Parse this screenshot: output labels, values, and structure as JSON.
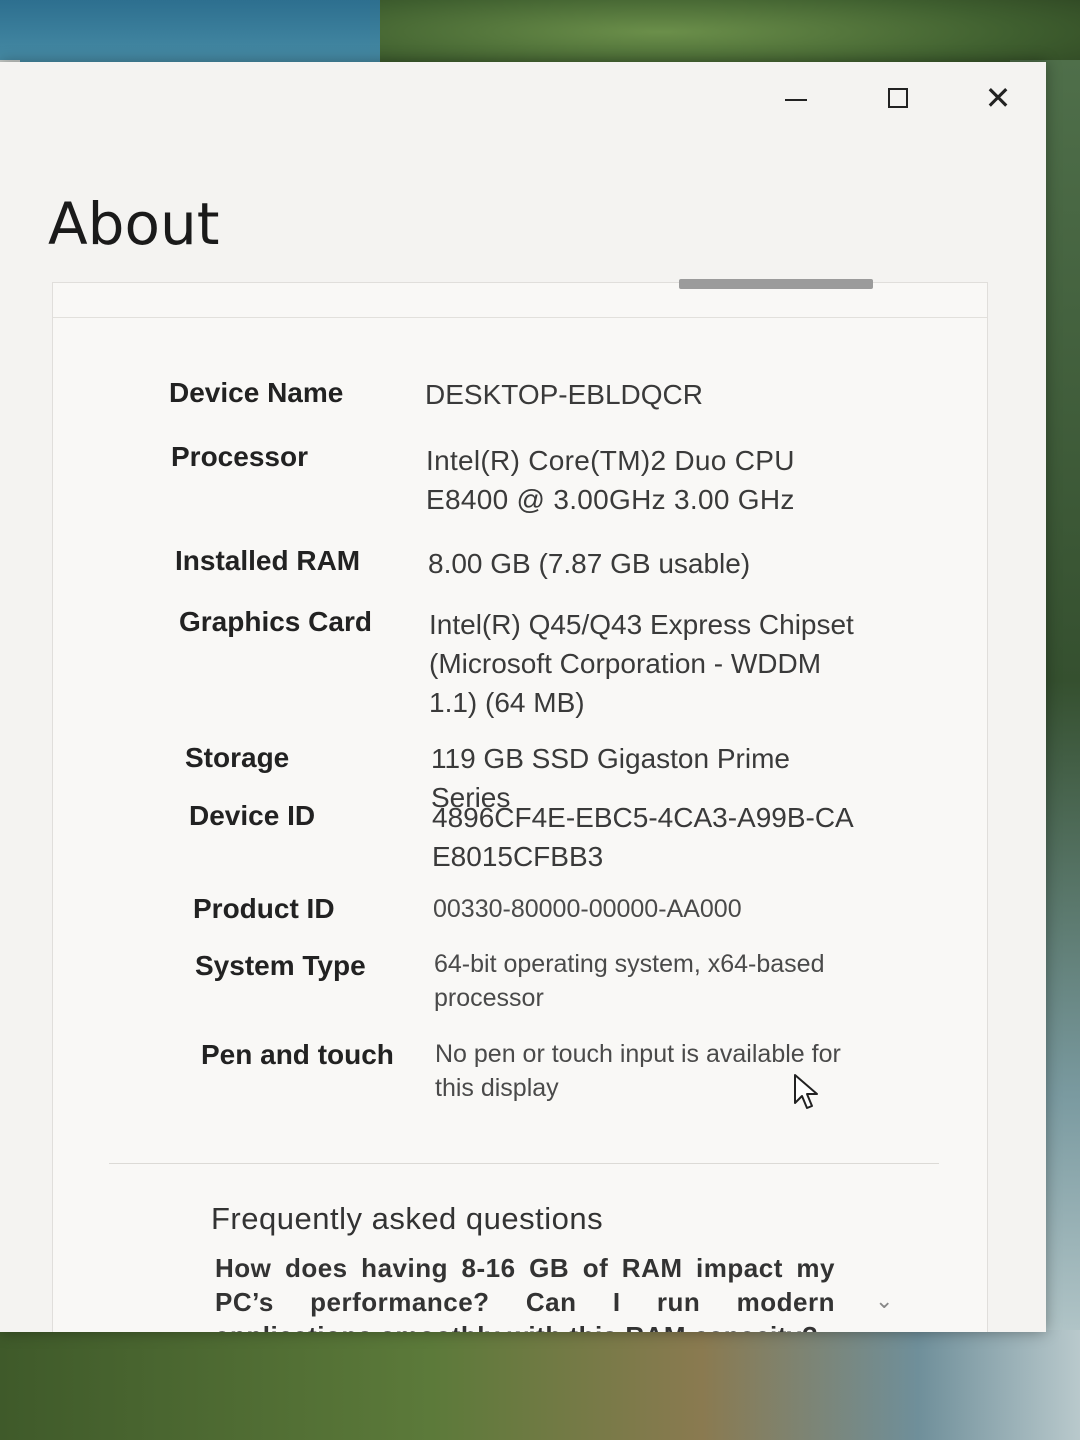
{
  "window": {
    "minimize_icon": "minimize-icon",
    "maximize_icon": "maximize-icon",
    "close_icon": "close-icon",
    "close_glyph": "✕"
  },
  "page": {
    "title": "About"
  },
  "specs": [
    {
      "label": "Device Name",
      "value": "DESKTOP-EBLDQCR"
    },
    {
      "label": "Processor",
      "value": "Intel(R) Core(TM)2 Duo CPU E8400 @ 3.00GHz 3.00 GHz"
    },
    {
      "label": "Installed RAM",
      "value": "8.00 GB (7.87 GB usable)"
    },
    {
      "label": "Graphics Card",
      "value": "Intel(R) Q45/Q43 Express Chipset (Microsoft Corporation - WDDM 1.1) (64 MB)"
    },
    {
      "label": "Storage",
      "value": "119 GB SSD Gigaston Prime Series"
    },
    {
      "label": "Device ID",
      "value": "4896CF4E-EBC5-4CA3-A99B-CAE8015CFBB3"
    },
    {
      "label": "Product ID",
      "value": "00330-80000-00000-AA000"
    },
    {
      "label": "System Type",
      "value": "64-bit operating system, x64-based processor"
    },
    {
      "label": "Pen and touch",
      "value": "No pen or touch input is available for this display"
    }
  ],
  "faq": {
    "title": "Frequently asked questions",
    "question": "How does having 8-16 GB of RAM impact my PC’s performance? Can I run modern applications smoothly with this RAM capacity?",
    "expand_icon": "chevron-down-icon",
    "chevron_glyph": "⌄"
  }
}
